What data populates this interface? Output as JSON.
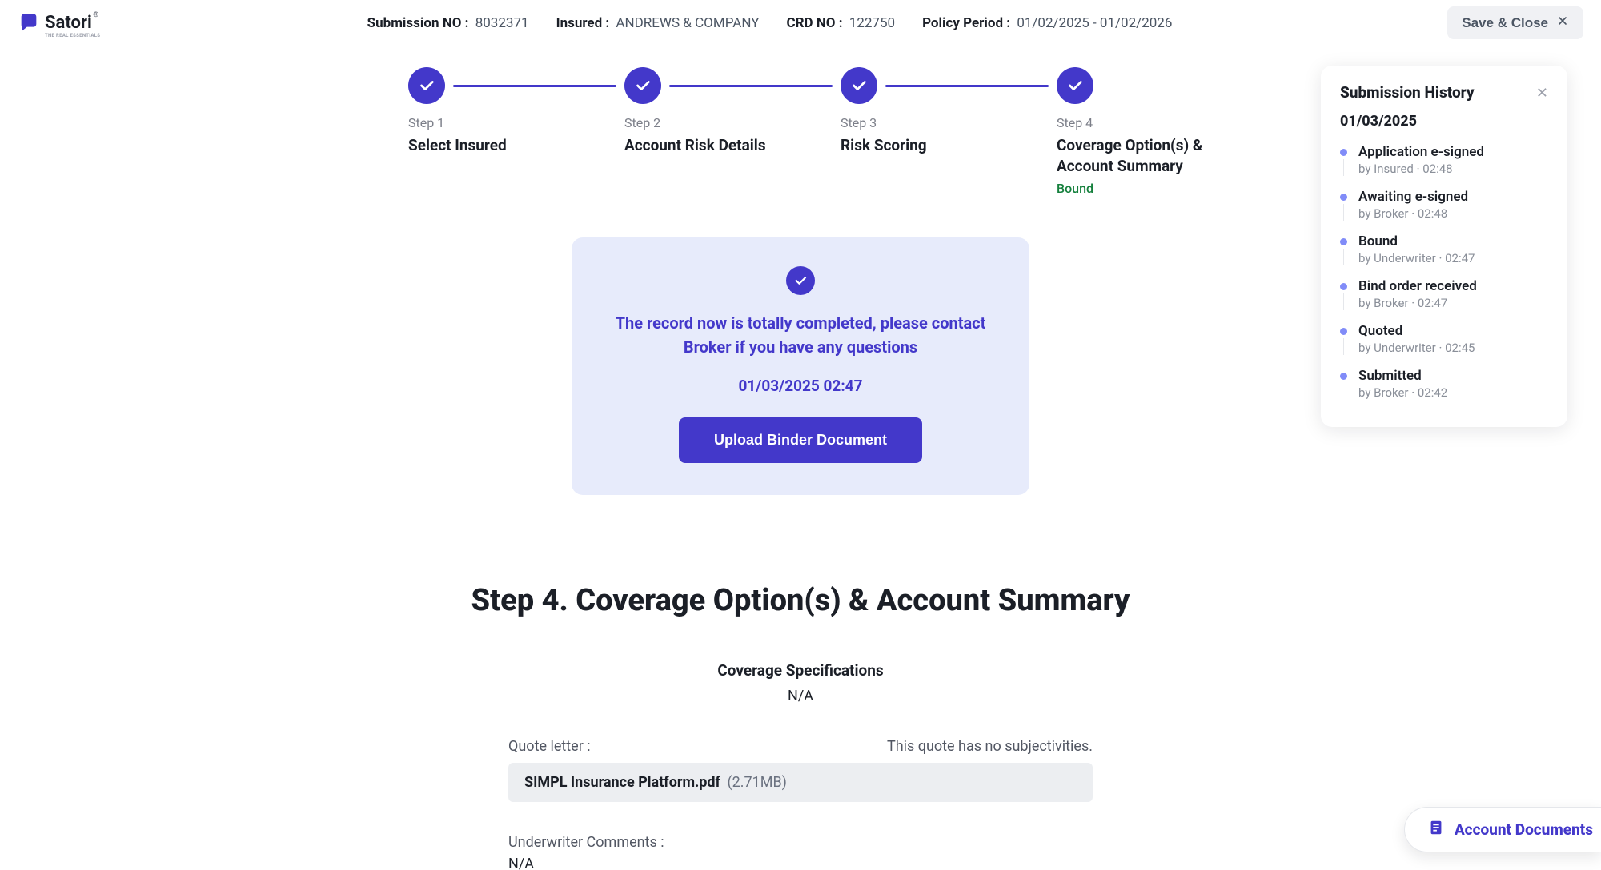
{
  "brand": {
    "name": "Satori",
    "sup": "®",
    "sub": "THE REAL ESSENTIALS"
  },
  "header": {
    "submission_no_label": "Submission NO :",
    "submission_no": "8032371",
    "insured_label": "Insured :",
    "insured": "ANDREWS & COMPANY",
    "crd_no_label": "CRD NO :",
    "crd_no": "122750",
    "policy_period_label": "Policy Period :",
    "policy_period": "01/02/2025 - 01/02/2026",
    "save_close": "Save & Close"
  },
  "steps": [
    {
      "num": "Step 1",
      "title": "Select Insured"
    },
    {
      "num": "Step 2",
      "title": "Account Risk Details"
    },
    {
      "num": "Step 3",
      "title": "Risk Scoring"
    },
    {
      "num": "Step 4",
      "title": "Coverage Option(s) & Account Summary",
      "sub": "Bound"
    }
  ],
  "complete": {
    "message": "The record now is totally completed, please contact Broker if you have any questions",
    "timestamp": "01/03/2025 02:47",
    "upload_label": "Upload Binder Document"
  },
  "section": {
    "heading": "Step 4. Coverage Option(s) & Account Summary",
    "spec_heading": "Coverage Specifications",
    "spec_value": "N/A"
  },
  "quote": {
    "label": "Quote letter :",
    "note": "This quote has no subjectivities.",
    "file_name": "SIMPL Insurance Platform.pdf",
    "file_size": "(2.71MB)"
  },
  "uw": {
    "label": "Underwriter Comments :",
    "value": "N/A"
  },
  "history": {
    "title": "Submission History",
    "date": "01/03/2025",
    "items": [
      {
        "title": "Application e-signed",
        "meta": "by Insured · 02:48"
      },
      {
        "title": "Awaiting e-signed",
        "meta": "by Broker · 02:48"
      },
      {
        "title": "Bound",
        "meta": "by Underwriter · 02:47"
      },
      {
        "title": "Bind order received",
        "meta": "by Broker · 02:47"
      },
      {
        "title": "Quoted",
        "meta": "by Underwriter · 02:45"
      },
      {
        "title": "Submitted",
        "meta": "by Broker · 02:42"
      }
    ]
  },
  "account_docs_label": "Account Documents"
}
